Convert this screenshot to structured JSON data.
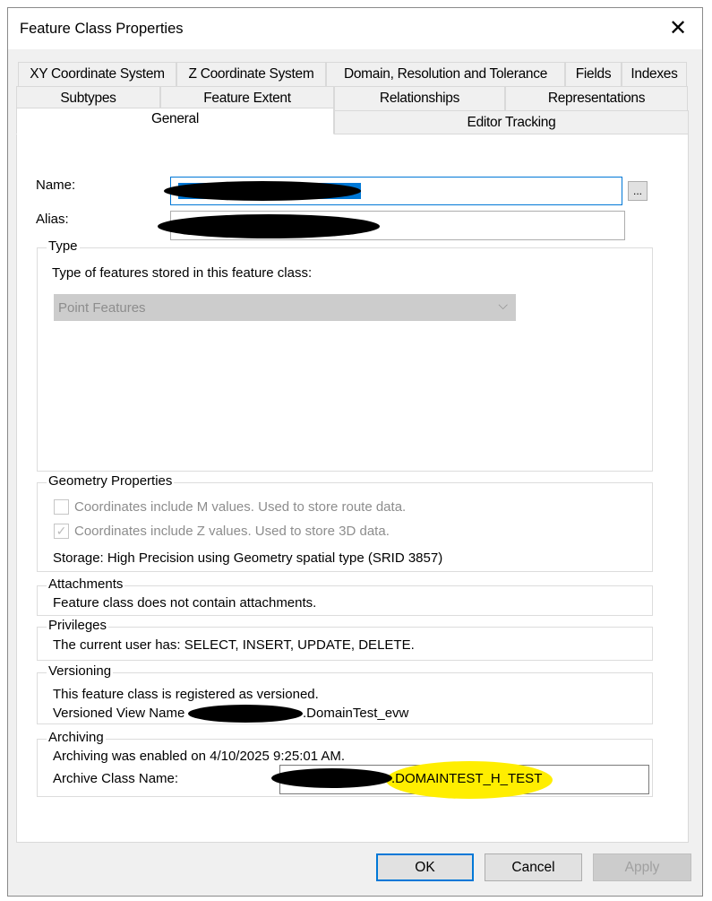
{
  "window": {
    "title": "Feature Class Properties",
    "close_icon": "close-icon"
  },
  "tabs": {
    "row1": [
      "XY Coordinate System",
      "Z Coordinate System",
      "Domain, Resolution and Tolerance",
      "Fields",
      "Indexes"
    ],
    "row2": [
      "Subtypes",
      "Feature Extent",
      "Relationships",
      "Representations"
    ],
    "row3": [
      "General",
      "Editor Tracking"
    ],
    "selected": "General"
  },
  "general": {
    "name_label": "Name:",
    "alias_label": "Alias:",
    "browse_label": "...",
    "type": {
      "title": "Type",
      "description": "Type of features stored in this feature class:",
      "selected": "Point Features"
    },
    "geometry": {
      "title": "Geometry Properties",
      "m_values": {
        "label": "Coordinates include M values. Used to store route data.",
        "checked": false
      },
      "z_values": {
        "label": "Coordinates include Z values. Used to store 3D data.",
        "checked": true
      },
      "storage": "Storage: High Precision using Geometry spatial type (SRID 3857)"
    },
    "attachments": {
      "title": "Attachments",
      "text": "Feature class does not contain attachments."
    },
    "privileges": {
      "title": "Privileges",
      "text": "The current user has: SELECT, INSERT, UPDATE, DELETE."
    },
    "versioning": {
      "title": "Versioning",
      "line1": "This feature class is registered as versioned.",
      "view_label": "Versioned View Name",
      "view_suffix": ".DomainTest_evw"
    },
    "archiving": {
      "title": "Archiving",
      "enabled_text": "Archiving was enabled on 4/10/2025 9:25:01 AM.",
      "class_label": "Archive Class Name:",
      "class_suffix": ".DOMAINTEST_H_TEST"
    }
  },
  "buttons": {
    "ok": "OK",
    "cancel": "Cancel",
    "apply": "Apply"
  },
  "colors": {
    "highlight": "#ffee00",
    "focus": "#0078d7"
  }
}
